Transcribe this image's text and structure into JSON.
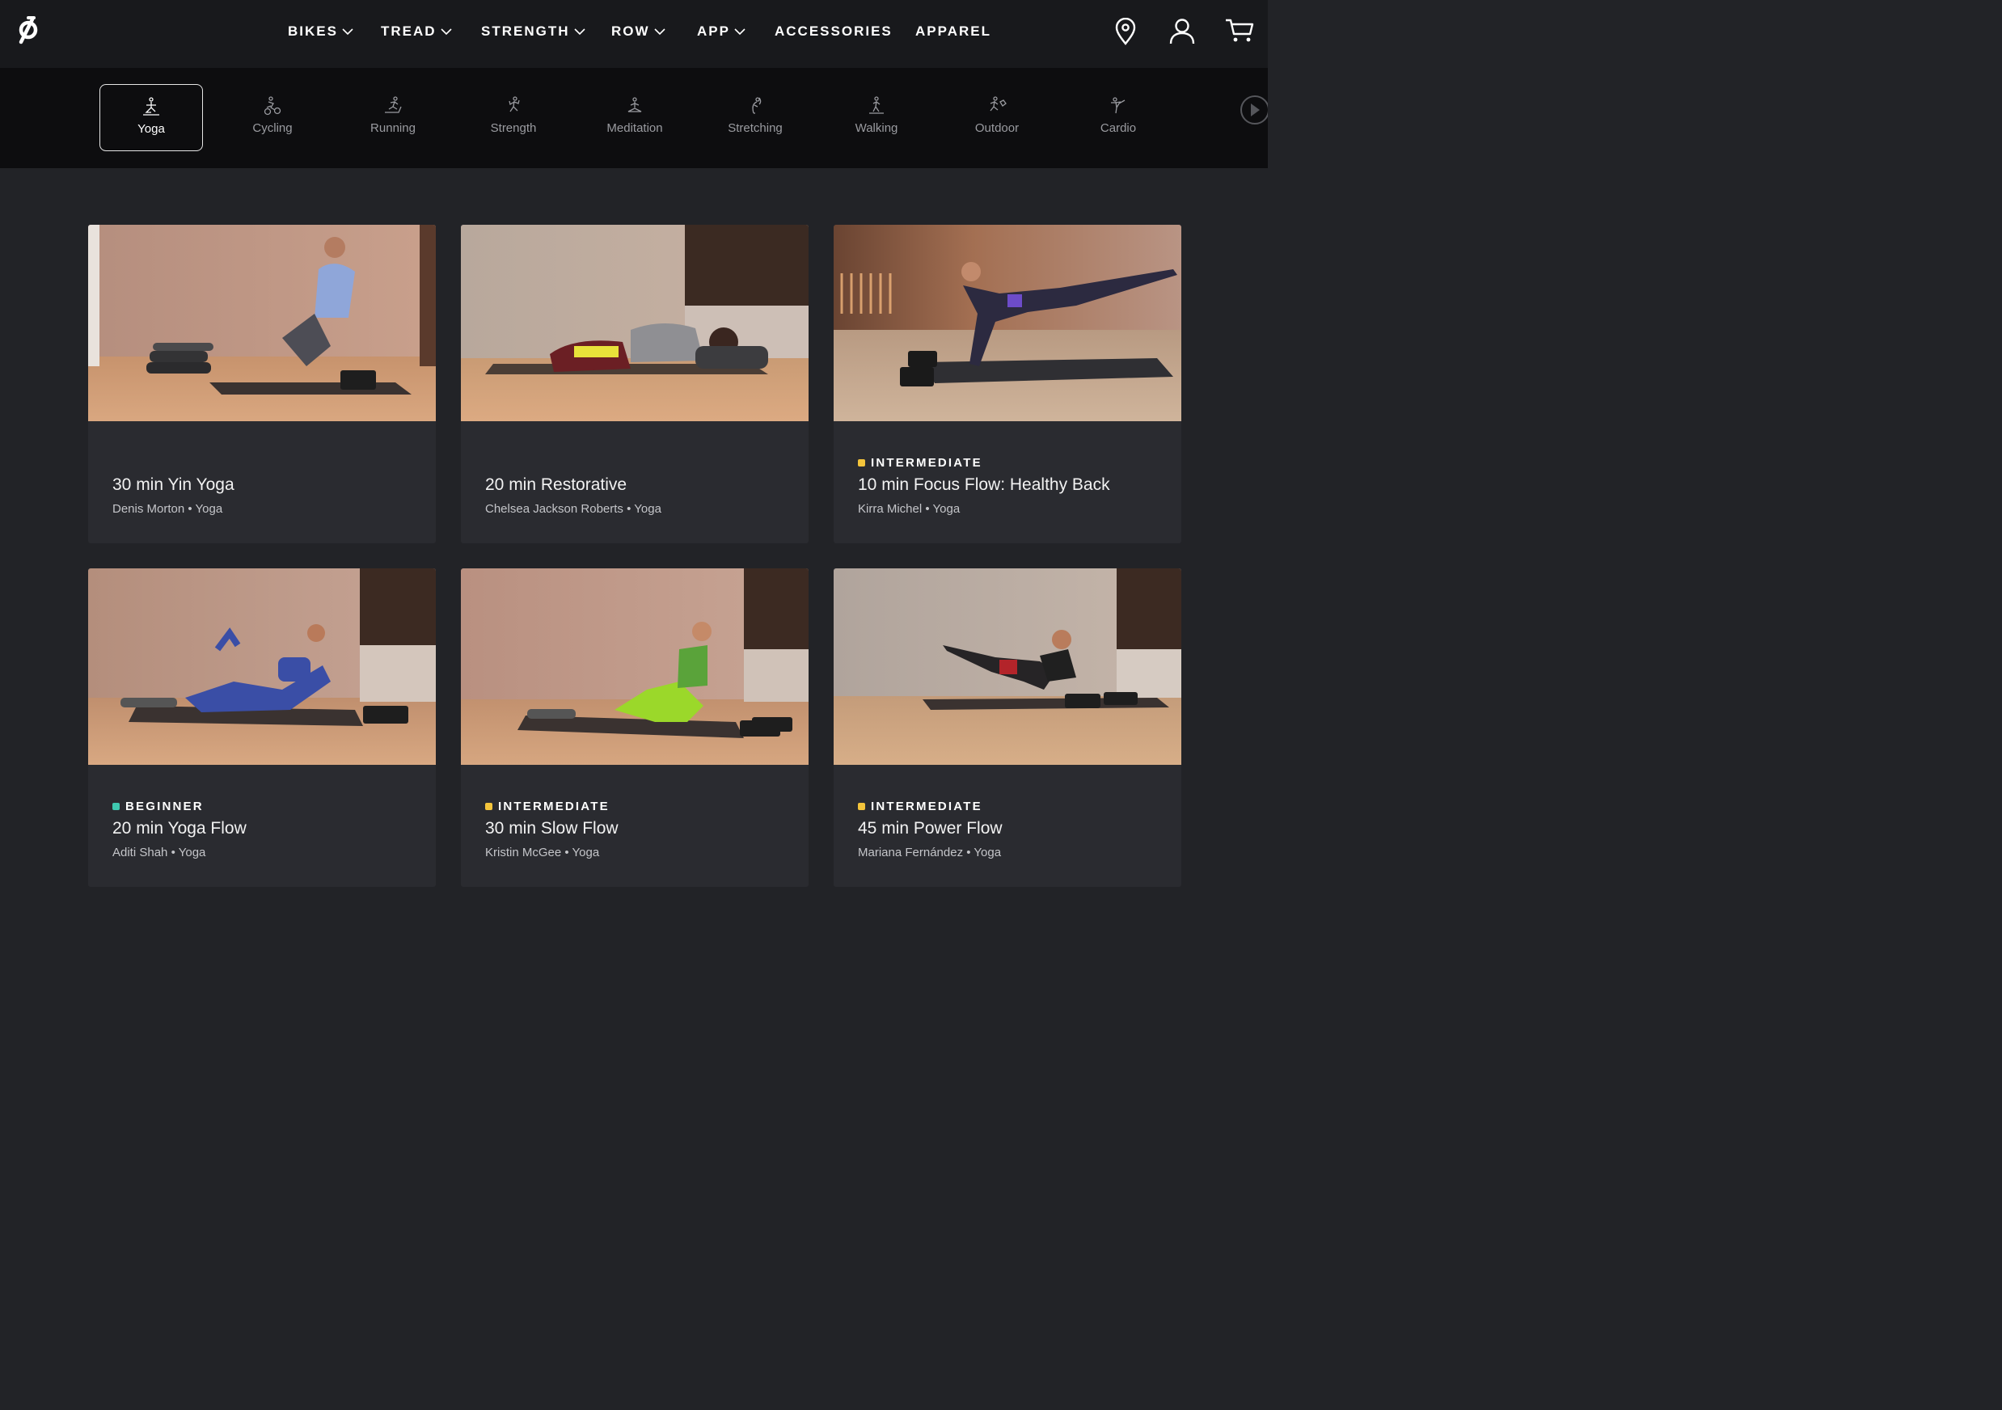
{
  "nav": {
    "items": [
      {
        "label": "BIKES",
        "dropdown": true
      },
      {
        "label": "TREAD",
        "dropdown": true
      },
      {
        "label": "STRENGTH",
        "dropdown": true
      },
      {
        "label": "ROW",
        "dropdown": true
      },
      {
        "label": "APP",
        "dropdown": true
      },
      {
        "label": "ACCESSORIES",
        "dropdown": false
      },
      {
        "label": "APPAREL",
        "dropdown": false
      }
    ],
    "icons": [
      "location-pin-icon",
      "account-icon",
      "cart-icon"
    ]
  },
  "categories": {
    "selected": "Yoga",
    "items": [
      {
        "label": "Yoga",
        "icon": "yoga-icon"
      },
      {
        "label": "Cycling",
        "icon": "cycling-icon"
      },
      {
        "label": "Running",
        "icon": "running-icon"
      },
      {
        "label": "Strength",
        "icon": "strength-icon"
      },
      {
        "label": "Meditation",
        "icon": "meditation-icon"
      },
      {
        "label": "Stretching",
        "icon": "stretching-icon"
      },
      {
        "label": "Walking",
        "icon": "walking-icon"
      },
      {
        "label": "Outdoor",
        "icon": "outdoor-icon"
      },
      {
        "label": "Cardio",
        "icon": "cardio-icon"
      }
    ]
  },
  "classes": [
    {
      "level": "",
      "title": "30 min Yin Yoga",
      "instructor": "Denis Morton",
      "discipline": "Yoga",
      "separator": "•"
    },
    {
      "level": "",
      "title": "20 min Restorative",
      "instructor": "Chelsea Jackson Roberts",
      "discipline": "Yoga",
      "separator": "•"
    },
    {
      "level": "INTERMEDIATE",
      "title": "10 min Focus Flow: Healthy Back",
      "instructor": "Kirra Michel",
      "discipline": "Yoga",
      "separator": "•"
    },
    {
      "level": "BEGINNER",
      "title": "20 min Yoga Flow",
      "instructor": "Aditi Shah",
      "discipline": "Yoga",
      "separator": "•"
    },
    {
      "level": "INTERMEDIATE",
      "title": "30 min Slow Flow",
      "instructor": "Kristin McGee",
      "discipline": "Yoga",
      "separator": "•"
    },
    {
      "level": "INTERMEDIATE",
      "title": "45 min Power Flow",
      "instructor": "Mariana Fernández",
      "discipline": "Yoga",
      "separator": "•"
    }
  ],
  "colors": {
    "beginner": "#3fc9b0",
    "intermediate": "#f3c43b",
    "background": "#222327",
    "card": "#2a2b30",
    "nav": "#18191c"
  }
}
